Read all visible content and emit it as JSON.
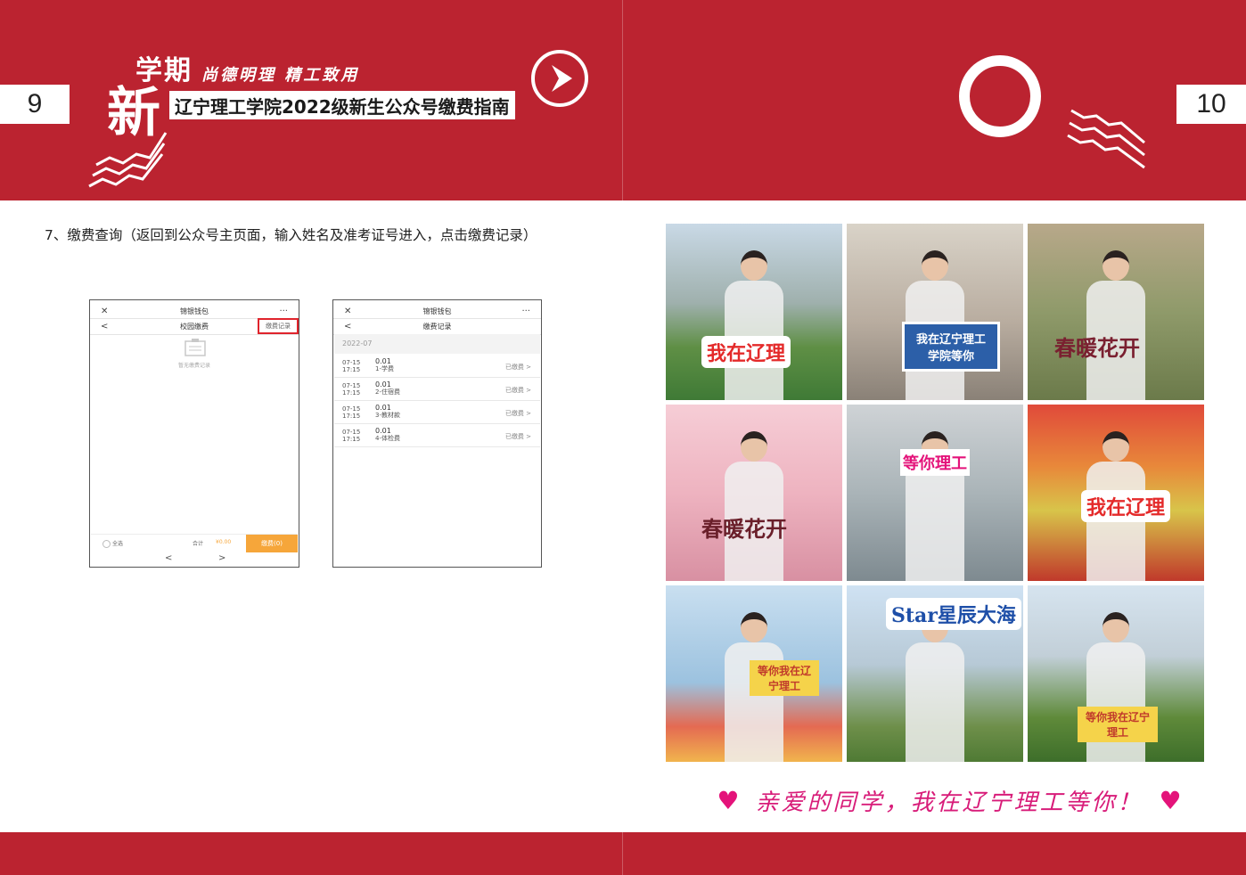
{
  "pages": {
    "left_number": "9",
    "right_number": "10"
  },
  "header": {
    "xin": "新",
    "xueqi": "学期",
    "motto": "尚德明理 精工致用",
    "title": "辽宁理工学院2022级新生公众号缴费指南"
  },
  "step": {
    "text": "7、缴费查询（返回到公众号主页面，输入姓名及准考证号进入，点击缴费记录）"
  },
  "phone1": {
    "app_title": "锦银钱包",
    "close": "✕",
    "more": "···",
    "back": "<",
    "nav_title": "校园缴费",
    "records_link": "缴费记录",
    "empty_text": "暂无缴费记录",
    "select_all": "全选",
    "total_label": "合计",
    "total_value": "¥0.00",
    "pay_button": "缴费(0)",
    "prev": "<",
    "next": ">"
  },
  "phone2": {
    "app_title": "锦银钱包",
    "close": "✕",
    "more": "···",
    "back": "<",
    "nav_title": "缴费记录",
    "month": "2022-07",
    "records": [
      {
        "date": "07-15",
        "time": "17:15",
        "amount": "0.01",
        "item": "1-学费",
        "status": "已缴费 >"
      },
      {
        "date": "07-15",
        "time": "17:15",
        "amount": "0.01",
        "item": "2-住宿费",
        "status": "已缴费 >"
      },
      {
        "date": "07-15",
        "time": "17:15",
        "amount": "0.01",
        "item": "3-教材款",
        "status": "已缴费 >"
      },
      {
        "date": "07-15",
        "time": "17:15",
        "amount": "0.01",
        "item": "4-体检费",
        "status": "已缴费 >"
      }
    ]
  },
  "photos": [
    {
      "sign": "我在辽理"
    },
    {
      "sign": "我在辽宁理工学院等你"
    },
    {
      "sign": "春暖花开"
    },
    {
      "sign": "春暖花开"
    },
    {
      "sign": "等你理工"
    },
    {
      "sign": "我在辽理"
    },
    {
      "sign": "等你我在辽宁理工"
    },
    {
      "sign": "Star星辰大海"
    },
    {
      "sign": "等你我在辽宁理工"
    }
  ],
  "slogan": {
    "text": "亲爱的同学，我在辽宁理工等你！",
    "heart": "♥"
  },
  "colors": {
    "brand_red": "#bb2330",
    "accent_pink": "#d81c79",
    "pay_orange": "#f6a63a",
    "highlight_red": "#e0242c"
  }
}
